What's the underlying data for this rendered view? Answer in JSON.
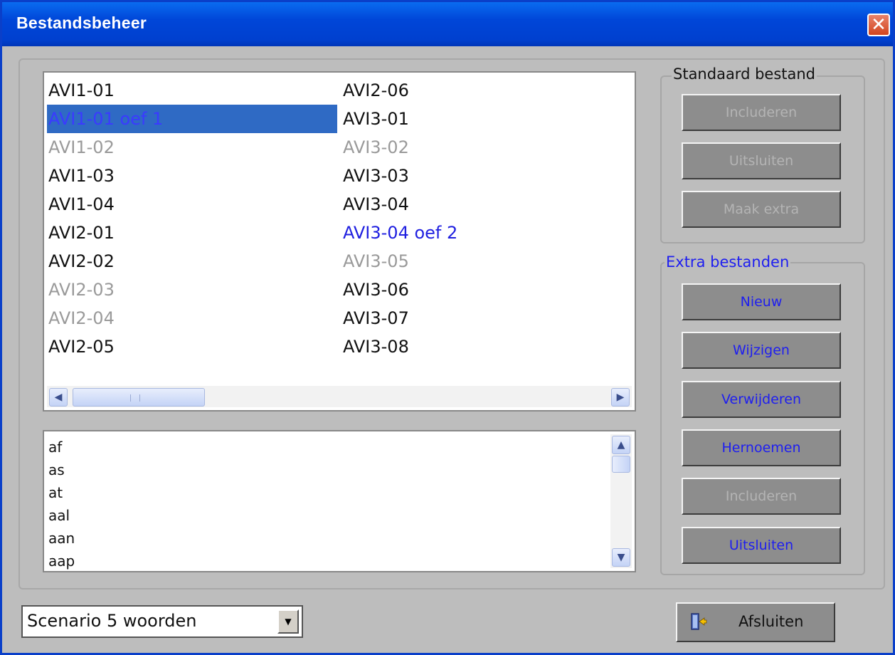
{
  "window": {
    "title": "Bestandsbeheer",
    "close_symbol": "✕"
  },
  "file_list": {
    "column1": [
      {
        "label": "AVI1-01",
        "state": "normal"
      },
      {
        "label": "AVI1-01 oef 1",
        "state": "selected"
      },
      {
        "label": "AVI1-02",
        "state": "disabled"
      },
      {
        "label": "AVI1-03",
        "state": "normal"
      },
      {
        "label": "AVI1-04",
        "state": "normal"
      },
      {
        "label": "AVI2-01",
        "state": "normal"
      },
      {
        "label": "AVI2-02",
        "state": "normal"
      },
      {
        "label": "AVI2-03",
        "state": "disabled"
      },
      {
        "label": "AVI2-04",
        "state": "disabled"
      },
      {
        "label": "AVI2-05",
        "state": "normal"
      }
    ],
    "column2": [
      {
        "label": "AVI2-06",
        "state": "normal"
      },
      {
        "label": "AVI3-01",
        "state": "normal"
      },
      {
        "label": "AVI3-02",
        "state": "disabled"
      },
      {
        "label": "AVI3-03",
        "state": "normal"
      },
      {
        "label": "AVI3-04",
        "state": "normal"
      },
      {
        "label": "AVI3-04 oef 2",
        "state": "extra"
      },
      {
        "label": "AVI3-05",
        "state": "disabled"
      },
      {
        "label": "AVI3-06",
        "state": "normal"
      },
      {
        "label": "AVI3-07",
        "state": "normal"
      },
      {
        "label": "AVI3-08",
        "state": "normal"
      }
    ]
  },
  "word_list": {
    "words": [
      "af",
      "as",
      "at",
      "aal",
      "aan",
      "aap"
    ]
  },
  "standard_group": {
    "title": "Standaard bestand",
    "include_label": "Includeren",
    "exclude_label": "Uitsluiten",
    "make_extra_label": "Maak extra"
  },
  "extra_group": {
    "title": "Extra bestanden",
    "new_label": "Nieuw",
    "edit_label": "Wijzigen",
    "delete_label": "Verwijderen",
    "rename_label": "Hernoemen",
    "include_label": "Includeren",
    "exclude_label": "Uitsluiten"
  },
  "scenario": {
    "selected": "Scenario 5 woorden"
  },
  "footer": {
    "close_label": "Afsluiten"
  },
  "colors": {
    "title_bar": "#0046d8",
    "selection": "#2f6ac4",
    "extra_text": "#2020e0",
    "disabled_text": "#9a9a9a",
    "button_face": "#8d8d8d"
  }
}
